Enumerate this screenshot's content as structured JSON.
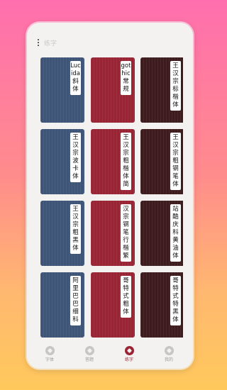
{
  "header": {
    "title": "练字"
  },
  "fonts": [
    {
      "label": "Lucida斜体",
      "color": "blue"
    },
    {
      "label": "gothic常规",
      "color": "red"
    },
    {
      "label": "王汉宗标楷体",
      "color": "dark"
    },
    {
      "label": "王汉宗波卡体",
      "color": "blue"
    },
    {
      "label": "王汉宗粗楷体简",
      "color": "red"
    },
    {
      "label": "王汉宗粗钢笔体",
      "color": "dark"
    },
    {
      "label": "王汉宗粗黑体",
      "color": "blue"
    },
    {
      "label": "汉宗钢笔行楷繁",
      "color": "red"
    },
    {
      "label": "站酷庆科黄油体",
      "color": "dark"
    },
    {
      "label": "阿里巴巴细科",
      "color": "blue"
    },
    {
      "label": "哥特式粗体",
      "color": "red"
    },
    {
      "label": "哥特式特黑体",
      "color": "dark"
    }
  ],
  "nav": [
    {
      "label": "字体",
      "active": false
    },
    {
      "label": "答题",
      "active": false
    },
    {
      "label": "练字",
      "active": true
    },
    {
      "label": "我的",
      "active": false
    }
  ],
  "system_nav": [
    "square-button",
    "circle-button",
    "back-triangle-button"
  ]
}
